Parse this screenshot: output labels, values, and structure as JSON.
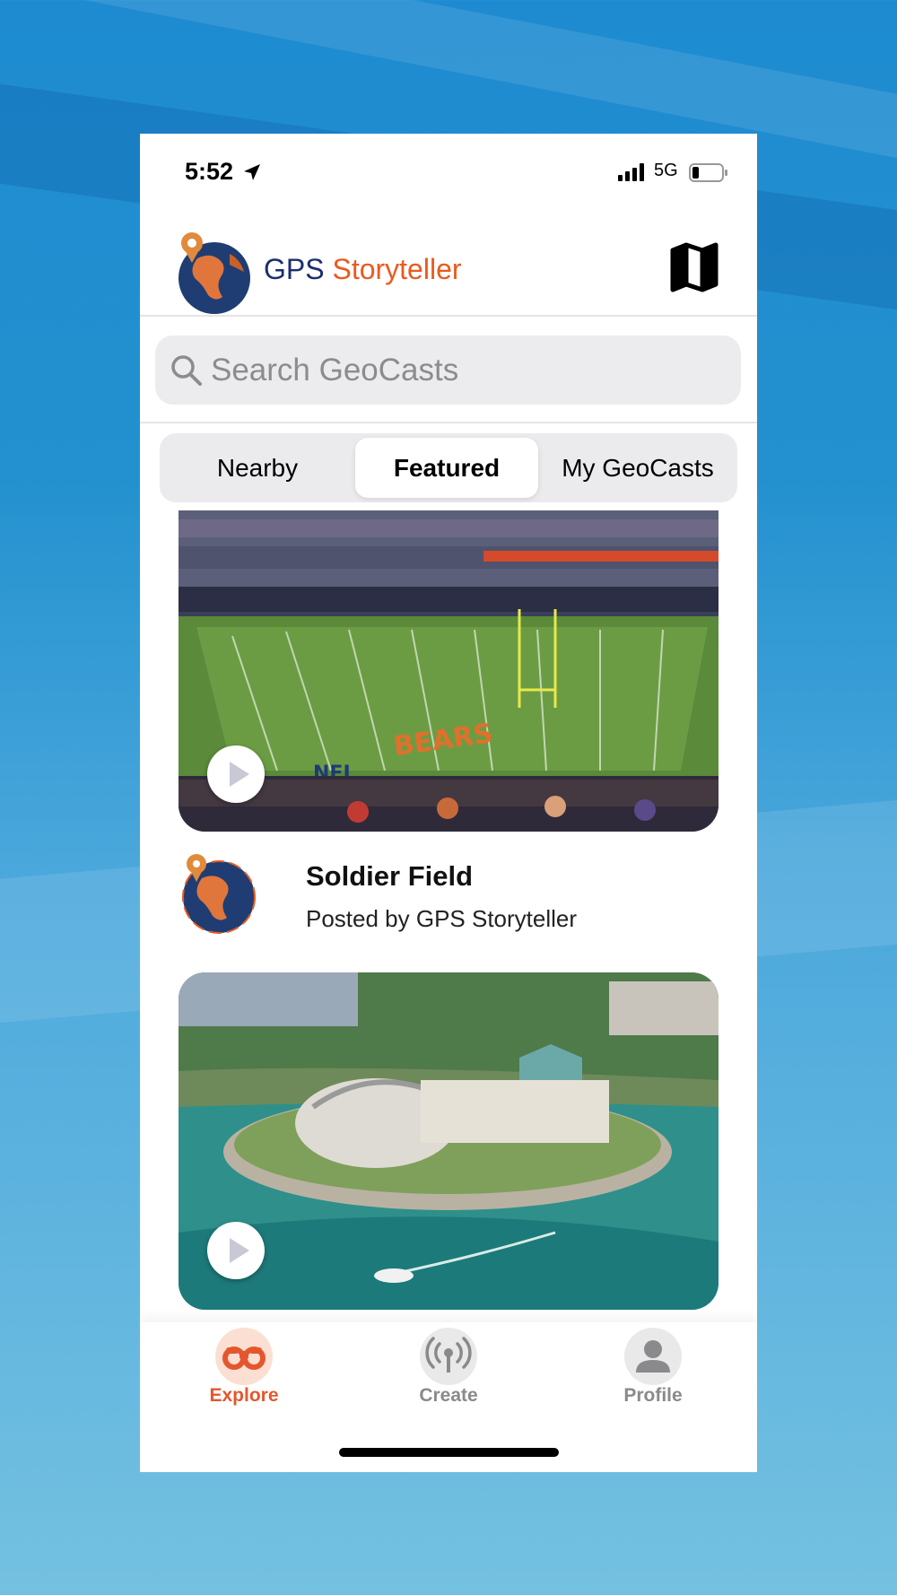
{
  "status_bar": {
    "time": "5:52",
    "network": "5G",
    "icons": [
      "location-arrow-icon",
      "signal-icon",
      "battery-icon"
    ]
  },
  "header": {
    "title_part1": "GPS",
    "title_part2": "Storyteller",
    "brand_colors": {
      "navy": "#1c2e6e",
      "orange": "#ea5a1e"
    },
    "map_icon": "map-icon"
  },
  "search": {
    "placeholder": "Search GeoCasts",
    "value": ""
  },
  "segments": [
    {
      "label": "Nearby",
      "active": false
    },
    {
      "label": "Featured",
      "active": true
    },
    {
      "label": "My GeoCasts",
      "active": false
    }
  ],
  "feed": [
    {
      "title": "Soldier Field",
      "author": "Posted by GPS Storyteller",
      "image": "football-stadium"
    },
    {
      "title": "",
      "author": "",
      "image": "aquarium-lakefront"
    }
  ],
  "tabs": [
    {
      "label": "Explore",
      "icon": "binoculars-icon",
      "active": true
    },
    {
      "label": "Create",
      "icon": "broadcast-icon",
      "active": false
    },
    {
      "label": "Profile",
      "icon": "person-icon",
      "active": false
    }
  ]
}
